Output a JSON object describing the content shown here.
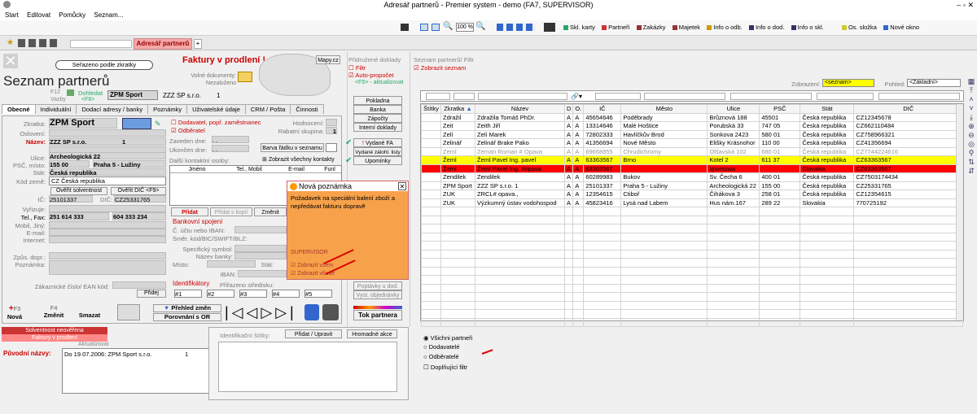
{
  "window": {
    "title": "Adresář partnerů - Premier system - demo (FA7, SUPERVISOR)",
    "controls": "‒  ▫  ✕"
  },
  "menu": [
    "Start",
    "Editovat",
    "Pomůcky",
    "Seznam..."
  ],
  "toolbar": {
    "zoom": "100 %",
    "items": [
      "Skl. karty",
      "Partneři",
      "Zakázky",
      "Majetek",
      "Info o odb.",
      "Info o dod.",
      "Info o skl.",
      "Os. složka",
      "Nové okno"
    ],
    "item_colors": [
      "#2a6",
      "#c33",
      "#933",
      "#933",
      "#c90",
      "#336",
      "#336",
      "#cc3",
      "#36c"
    ]
  },
  "tab": {
    "label": "Adresář partnerů"
  },
  "left": {
    "sort_label": "Seřazeno podle zkratky",
    "overdue": "Faktury v prodlení !",
    "map_label": "Mapy.cz",
    "docs_label": "Volné dokumenty:",
    "docs_value": "Nezaloženo",
    "heading": "Seznam partnerů",
    "f12": "F12",
    "vazby": "Vazby",
    "dohledat": "Dohledat",
    "f8": "<F8>",
    "code": "ZPM Sport",
    "company": "ZZZ SP s.r.o.",
    "num": "1",
    "tabs": [
      "Obecné",
      "Individuální",
      "Dodací adresy / banky",
      "Poznámky",
      "Uživatelské údaje",
      "CRM / Pošta",
      "Činnosti"
    ],
    "fields": {
      "zkratka_l": "Zkratka:",
      "zkratka": "ZPM Sport",
      "osloveni_l": "Oslovení:",
      "nazev_l": "Název:",
      "nazev": "ZZZ SP s.r.o.",
      "nazev_num": "1",
      "ulice_l": "Ulice:",
      "ulice": "Archeologická 22",
      "psc_l": "PSČ, místo:",
      "psc": "155 00",
      "misto": "Praha 5 - Lužiny",
      "stat_l": "Stát:",
      "stat": "Česká republika",
      "kod_l": "Kód země:",
      "kod": "CZ   Česká republika",
      "overit_solv": "Ověřit solventnost",
      "overit_dic": "Ověřit DIČ <F9>",
      "ic_l": "IČ:",
      "ic": "25101337",
      "dic_l": "DIČ:",
      "dic": "CZ25331765",
      "vyrizuje_l": "Vyřizuje:",
      "tel_l": "Tel., Fax:",
      "tel": "251 614 333",
      "fax": "604 333 234",
      "mobil_l": "Mobil, Jiný:",
      "email_l": "E-mail:",
      "internet_l": "Internet:",
      "zpus_l": "Způs. dopr.:",
      "pozn_l": "Poznámka:",
      "ean_l": "Zákaznické číslo/ EAN kód:",
      "pridej": "Přidej"
    },
    "mid": {
      "dodavatel": "Dodavatel, popř. zaměstnanec",
      "odberatel": "Odběratel",
      "hodnoceni_l": "Hodnocení:",
      "rabat_l": "Rabatní skupina:",
      "rabat": "1",
      "zaveden_l": "Zaveden dne:",
      "zaveden": ". .",
      "ukoncen_l": "Ukončen dne:",
      "ukoncen": ". .",
      "barva": "Barva řádku v seznamu",
      "dalsi": "Další kontaktní osoby:",
      "zobrazit_vse": "Zobrazit všechny kontakty",
      "cols": [
        "Jméno",
        "Tel., Mobil",
        "E-mail",
        "Funl"
      ],
      "pridat": "Přidat",
      "pridat_kopii": "Přidat s kopií",
      "zmenit": "Změnit",
      "bank": "Bankovní spojení",
      "ucet_l": "Č. účtu nebo IBAN:",
      "smer_l": "Směr. kód/BIC/SWIFT/BLZ:",
      "spec_l": "Specifický symbol:",
      "banka_l": "Název banky:",
      "misto_l": "Místo:",
      "stat2_l": "Stát:",
      "iban_l": "IBAN:",
      "ident": "Identifikátory",
      "prirazeno": "Přiřazeno středisku:",
      "ids": [
        "#1",
        "#2",
        "#3",
        "#4",
        "#5"
      ]
    },
    "docs": {
      "title": "Přidružené doklady",
      "filtr": "Filtr",
      "auto": "Auto-propočet",
      "f5": "<F5> - aktualizovat",
      "buttons": [
        "Pokladna",
        "Banka",
        "Zápočty",
        "Interní doklady"
      ],
      "vydane_fa": "Vydané FA",
      "vydane_zal": "Vydané zálohl. listy",
      "upominky": "Upomínky",
      "poptavky": "Poptávky u dod.",
      "objednavky": "Vyst. objednávky",
      "tok": "Tok partnera"
    },
    "bottom": {
      "nova": "Nová",
      "f3": "F3",
      "zmenit": "Změnit",
      "f4": "F4",
      "smazat": "Smazat",
      "prehled": "Přehled změn",
      "porovnani": "Porovnání s OR"
    }
  },
  "popup": {
    "title": "Nová poznámka",
    "text": "Požadavek na speciální balení zboží a nepředávat fakturu dopravě",
    "user": "SUPERVISOR",
    "opt1": "Zobrazit všem",
    "opt2": "Zobrazit všude"
  },
  "right": {
    "header": "Seznam partnerů/ Filtr",
    "zobrazit_seznam": "Zobrazit seznam",
    "zobrazeni_l": "Zobrazení:",
    "zobrazeni": "<seznam>",
    "pohled_l": "Pohled:",
    "pohled": "<Základní>",
    "columns": [
      "Štítky",
      "Zkratka",
      "Název",
      "D",
      "O.",
      "IČ",
      "Město",
      "Ulice",
      "PSČ",
      "Stát",
      "DIČ"
    ],
    "rows": [
      {
        "zkratka": "Zdražil",
        "nazev": "Zdražila Tomáš PhDr.",
        "d": "A",
        "o": "A",
        "ic": "45654646",
        "mesto": "Poděbrady",
        "ulice": "Brůznová 188",
        "psc": "45501",
        "stat": "Česká republika",
        "dic": "CZ12345678",
        "style": ""
      },
      {
        "zkratka": "Zeit",
        "nazev": "Zeith Jiří",
        "d": "A",
        "o": "A",
        "ic": "13314646",
        "mesto": "Malé Hoštice",
        "ulice": "Porubská 33",
        "psc": "747 05",
        "stat": "Česká republika",
        "dic": "CZ662110484",
        "style": ""
      },
      {
        "zkratka": "Zelí",
        "nazev": "Zelí Marek",
        "d": "A",
        "o": "A",
        "ic": "72802333",
        "mesto": "Havlíčkův Brod",
        "ulice": "Sonkova 2423",
        "psc": "580 01",
        "stat": "Česká republika",
        "dic": "CZ758966321",
        "style": ""
      },
      {
        "zkratka": "Zelinář",
        "nazev": "Zelinář Brake Pako",
        "d": "A",
        "o": "A",
        "ic": "41356694",
        "mesto": "Nové Město",
        "ulice": "Elišky Krásnohor",
        "psc": "110 00",
        "stat": "Česká republika",
        "dic": "CZ41356694",
        "style": ""
      },
      {
        "zkratka": "Zeml",
        "nazev": "Zeman Roman # Opava",
        "d": "A",
        "o": "A",
        "ic": "69668855",
        "mesto": "Chrudichromy",
        "ulice": "Olšavská 102",
        "psc": "680 01",
        "stat": "Česká republika",
        "dic": "CZ7744224616",
        "style": "gray"
      },
      {
        "zkratka": "Žeml",
        "nazev": "Žeml Pavel Ing. pavel",
        "d": "A",
        "o": "A",
        "ic": "63363567",
        "mesto": "Brno",
        "ulice": "Kotel 2",
        "psc": "611 37",
        "stat": "Česká republika",
        "dic": "CZ63363567",
        "style": "yellow"
      },
      {
        "zkratka": "Žeml",
        "nazev": "Žeml Pavel Ing. #opava",
        "d": "A",
        "o": "A",
        "ic": "63363567",
        "mesto": "",
        "ulice": "Igwetowa",
        "psc": "",
        "stat": "Slovakia",
        "dic": "CZ63363567",
        "style": "red"
      },
      {
        "zkratka": "Zendilek",
        "nazev": "Zendilek",
        "d": "A",
        "o": "A",
        "ic": "60289983",
        "mesto": "Bukov",
        "ulice": "Sv. Čecha 6",
        "psc": "400 01",
        "stat": "Česká republika",
        "dic": "CZ7503174434",
        "style": ""
      },
      {
        "zkratka": "ZPM Sport",
        "nazev": "ZZZ SP s.r.o.          1",
        "d": "A",
        "o": "A",
        "ic": "25101337",
        "mesto": "Praha 5 - Lužiny",
        "ulice": "Archeologická 22",
        "psc": "155 00",
        "stat": "Česká republika",
        "dic": "CZ25331765",
        "style": ""
      },
      {
        "zkratka": "ZUK",
        "nazev": "ZRCL# opava.,",
        "d": "A",
        "o": "A",
        "ic": "12354615",
        "mesto": "Ctiboř",
        "ulice": "Čihákova 3",
        "psc": "258 01",
        "stat": "Česká republika",
        "dic": "CZ12354615",
        "style": ""
      },
      {
        "zkratka": "ZUK",
        "nazev": "Výzkumný ústav vodohospod",
        "d": "A",
        "o": "A",
        "ic": "45823416",
        "mesto": "Lysá nad Labem",
        "ulice": "Hus nám.167",
        "psc": "289 22",
        "stat": "Slovakia",
        "dic": "770725192",
        "style": ""
      }
    ]
  },
  "footer": {
    "solv": "Solventnost neověřena",
    "faktury": "Faktury v prodlení",
    "aktualizovat": "Aktualizovat",
    "puvodni": "Původní názvy:",
    "puvodni_text": "Do 19.07.2006: ZPM Sport s.r.o.",
    "puvodni_num": "1",
    "ident_stitky": "Identifikační štítky:",
    "pridat_upravit": "Přidat / Upravit",
    "hromadne": "Hromadné akce",
    "radio": [
      "Všichni partneři",
      "Dodavatelé",
      "Odběratelé"
    ],
    "doplnujici": "Doplňující filtr"
  }
}
